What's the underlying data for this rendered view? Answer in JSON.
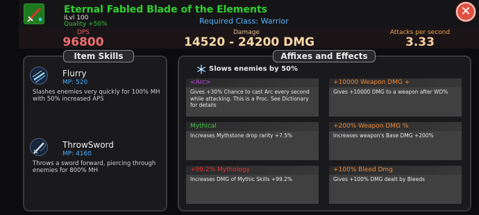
{
  "item": {
    "name": "Eternal Fabled Blade of the Elements",
    "ilvl": "iLvl 100",
    "quality": "Quality +50%",
    "required_class": "Required Class: Warrior",
    "icon": "sword-icon"
  },
  "close_label": "✕",
  "stats": {
    "dps_label": "DPS",
    "dps_value": "96800",
    "damage_label": "Damage",
    "damage_value": "14520 - 24200 DMG",
    "aps_label": "Attacks per second",
    "aps_value": "3.33"
  },
  "skills_panel": {
    "title": "Item Skills",
    "skills": [
      {
        "name": "Flurry",
        "mp": "MP: 520",
        "description": "Slashes enemies very quickly for 100% MH with 50% increased APS",
        "icon": "flurry-skill-icon"
      },
      {
        "name": "ThrowSword",
        "mp": "MP: 4160",
        "description": "Throws a sword forward, piercing through enemies for 800% MH",
        "icon": "throw-sword-skill-icon"
      }
    ]
  },
  "affixes_panel": {
    "title": "Affixes and Effects",
    "special_effect": "Slows enemies by 50%",
    "affixes": [
      {
        "title": "<Arc>",
        "color": "#c040e0",
        "description": "Gives +30% Chance to cast Arc every second while attacking. This is a Proc. See Dictionary for details"
      },
      {
        "title": "+10000 Weapon DMG +",
        "color": "#f08830",
        "description": "Gives +10000 DMG to a weapon after WD%"
      },
      {
        "title": "Mythical",
        "color": "#40c040",
        "description": "Increases Mythstone drop rarity +7.5%"
      },
      {
        "title": "+200% Weapon DMG %",
        "color": "#f08830",
        "description": "Increases weapon's Base DMG +200%"
      },
      {
        "title": "+99.2% Mythology",
        "color": "#e83030",
        "description": "Increases DMG of Mythic Skills +99.2%"
      },
      {
        "title": "+100% Bleed Dmg",
        "color": "#f08830",
        "description": "Gives +100% DMG dealt by Bleeds"
      }
    ]
  }
}
